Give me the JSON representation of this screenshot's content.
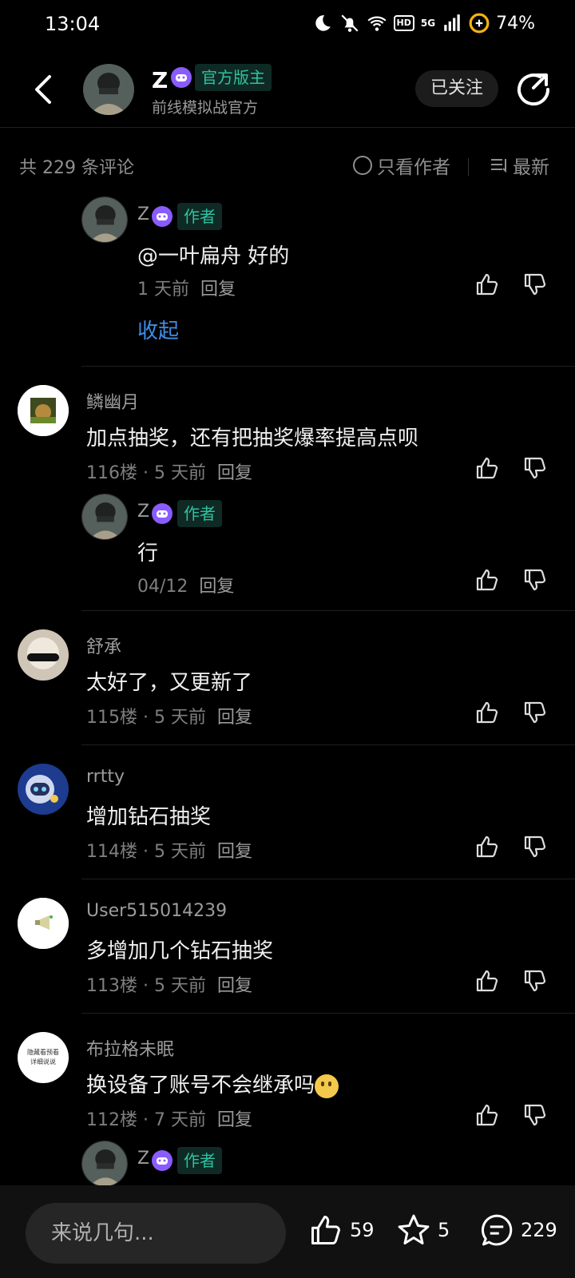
{
  "status_bar": {
    "time": "13:04",
    "hd": "HD",
    "network": "5G",
    "battery": "74%"
  },
  "header": {
    "author_name": "Z",
    "mod_tag": "官方版主",
    "subtitle": "前线模拟战官方",
    "follow_label": "已关注"
  },
  "filter": {
    "count_label": "共 229 条评论",
    "only_author_label": "只看作者",
    "sort_label": "最新"
  },
  "comments": [
    {
      "user": "Z",
      "tag": "作者",
      "text": "@一叶扁舟  好的",
      "meta": "1 天前",
      "reply": "回复"
    },
    {
      "user": "鳞幽月",
      "text": "加点抽奖，还有把抽奖爆率提高点呗",
      "meta": "116楼 · 5 天前",
      "reply": "回复"
    },
    {
      "user": "Z",
      "tag": "作者",
      "text": "行",
      "meta": "04/12",
      "reply": "回复"
    },
    {
      "user": "舒承",
      "text": "太好了，又更新了",
      "meta": "115楼 · 5 天前",
      "reply": "回复"
    },
    {
      "user": "rrtty",
      "text": "增加钻石抽奖",
      "meta": "114楼 · 5 天前",
      "reply": "回复"
    },
    {
      "user": "User515014239",
      "text": "多增加几个钻石抽奖",
      "meta": "113楼 · 5 天前",
      "reply": "回复"
    },
    {
      "user": "布拉格未眠",
      "text": "换设备了账号不会继承吗",
      "meta": "112楼 · 7 天前",
      "reply": "回复"
    },
    {
      "user": "Z",
      "tag": "作者"
    }
  ],
  "collapse_label": "收起",
  "avatar_text": {
    "line1": "隐藏看预看",
    "line2": "详细说说"
  },
  "bottom_bar": {
    "input_placeholder": "来说几句...",
    "likes": "59",
    "favorites": "5",
    "comments": "229"
  },
  "colors": {
    "accent_link": "#3e8ee8",
    "author_tag": "#2fc2a0",
    "background": "#000000"
  },
  "icons": [
    "back-icon",
    "share-icon",
    "like-icon",
    "dislike-icon",
    "star-icon",
    "comment-icon",
    "game-controller-icon",
    "sort-icon"
  ]
}
